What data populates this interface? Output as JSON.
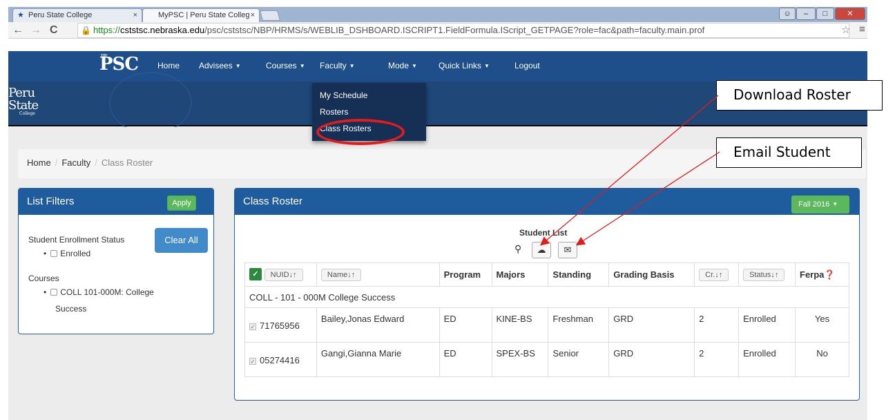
{
  "browser": {
    "tabs": [
      {
        "label": "Peru State College"
      },
      {
        "label": "MyPSC | Peru State Colleg"
      }
    ],
    "url_https": "https://",
    "url_host": "cststsc.nebraska.edu",
    "url_path": "/psc/cststsc/NBP/HRMS/s/WEBLIB_DSHBOARD.ISCRIPT1.FieldFormula.IScript_GETPAGE?role=fac&path=faculty.main.prof"
  },
  "nav": {
    "logo": "PSC",
    "logo_small": "my",
    "items": [
      {
        "label": "Home",
        "caret": false
      },
      {
        "label": "Advisees",
        "caret": true
      },
      {
        "label": "Courses",
        "caret": true
      },
      {
        "label": "Faculty",
        "caret": true
      },
      {
        "label": "Mode",
        "caret": true
      },
      {
        "label": "Quick Links",
        "caret": true
      },
      {
        "label": "Logout",
        "caret": false
      }
    ]
  },
  "brand": {
    "line1": "Peru",
    "line2": "State",
    "line3": "College"
  },
  "faculty_menu": [
    "My Schedule",
    "Rosters",
    "Class Rosters"
  ],
  "callouts": {
    "download": "Download Roster",
    "email": "Email Student"
  },
  "breadcrumb": {
    "home": "Home",
    "faculty": "Faculty",
    "current": "Class Roster"
  },
  "filters": {
    "title": "List Filters",
    "apply": "Apply",
    "clear": "Clear All",
    "enrollment_label": "Student Enrollment Status",
    "enrolled": "Enrolled",
    "courses_label": "Courses",
    "course_line1": "COLL 101-000M: College",
    "course_line2": "Success"
  },
  "roster": {
    "title": "Class Roster",
    "term": "Fall 2016",
    "list_title": "Student List",
    "columns": {
      "nuid": "NUID",
      "name": "Name",
      "program": "Program",
      "majors": "Majors",
      "standing": "Standing",
      "grading": "Grading Basis",
      "credits": "Cr.",
      "status": "Status",
      "ferpa": "Ferpa"
    },
    "group": "COLL - 101 - 000M College Success",
    "rows": [
      {
        "nuid": "71765956",
        "name": "Bailey,Jonas Edward",
        "program": "ED",
        "majors": "KINE-BS",
        "standing": "Freshman",
        "grading": "GRD",
        "credits": "2",
        "status": "Enrolled",
        "ferpa": "Yes"
      },
      {
        "nuid": "05274416",
        "name": "Gangi,Gianna Marie",
        "program": "ED",
        "majors": "SPEX-BS",
        "standing": "Senior",
        "grading": "GRD",
        "credits": "2",
        "status": "Enrolled",
        "ferpa": "No"
      }
    ]
  },
  "colors": {
    "nav": "#1e4f8a",
    "panel_head": "#1f5c9e",
    "green": "#5cb85c",
    "highlight": "#e31b1b"
  }
}
